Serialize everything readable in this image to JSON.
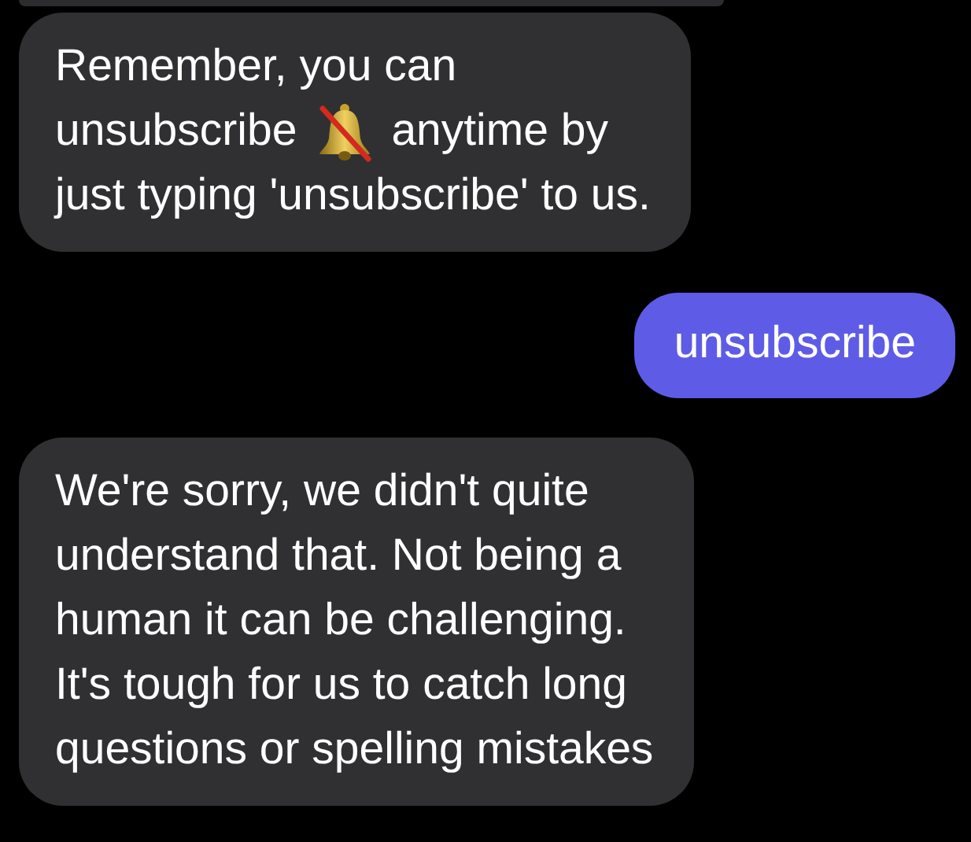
{
  "messages": [
    {
      "kind": "incoming",
      "lines": [
        [
          {
            "kind": "text",
            "text": "Remember, you can"
          }
        ],
        [
          {
            "kind": "text",
            "text": "unsubscribe"
          },
          {
            "kind": "muted-bell"
          },
          {
            "kind": "text",
            "text": "anytime by"
          }
        ],
        [
          {
            "kind": "text",
            "text": "just typing 'unsubscribe' to us."
          }
        ]
      ]
    },
    {
      "kind": "outgoing",
      "lines": [
        [
          {
            "kind": "text",
            "text": "unsubscribe"
          }
        ]
      ]
    },
    {
      "kind": "incoming",
      "lines": [
        [
          {
            "kind": "text",
            "text": "We're sorry, we didn't quite"
          }
        ],
        [
          {
            "kind": "text",
            "text": "understand that. Not being a"
          }
        ],
        [
          {
            "kind": "text",
            "text": "human it can be challenging."
          }
        ],
        [
          {
            "kind": "text",
            "text": "It's tough for us to catch long"
          }
        ],
        [
          {
            "kind": "text",
            "text": "questions or spelling mistakes"
          }
        ]
      ]
    }
  ]
}
